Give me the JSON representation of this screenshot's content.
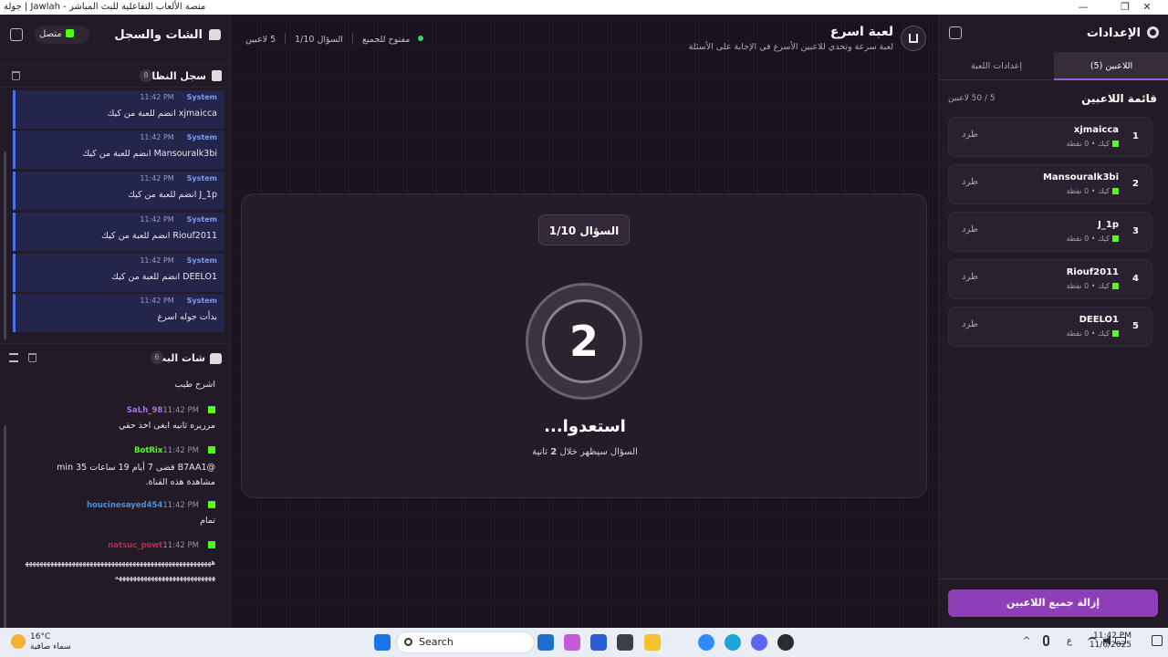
{
  "window": {
    "title": "منصة الألعاب التفاعلية للبث المباشر - Jawlah | جولة",
    "controls": [
      "—",
      "❐",
      "✕"
    ]
  },
  "left_panel": {
    "title": "الشات والسجل",
    "status": "متصل",
    "system_log": {
      "title": "سجل النظام",
      "count": "8",
      "items": [
        {
          "sender": "System",
          "time": "11:42 PM",
          "message": "xjmaicca انضم للعبة من كيك"
        },
        {
          "sender": "System",
          "time": "11:42 PM",
          "message": "Mansouralk3bi انضم للعبة من كيك"
        },
        {
          "sender": "System",
          "time": "11:42 PM",
          "message": "J_1p انضم للعبة من كيك"
        },
        {
          "sender": "System",
          "time": "11:42 PM",
          "message": "Riouf2011 انضم للعبة من كيك"
        },
        {
          "sender": "System",
          "time": "11:42 PM",
          "message": "DEELO1 انضم للعبة من كيك"
        },
        {
          "sender": "System",
          "time": "11:42 PM",
          "message": "بدأت جوله اسرع"
        }
      ]
    },
    "stream_chat": {
      "title": "شات البث",
      "count": "6",
      "messages": [
        {
          "user": "",
          "time": "",
          "text": "اشرح طيب",
          "color": "#ffffff"
        },
        {
          "user": "SaLh_98",
          "time": "11:42 PM",
          "text": "مرريره ثانيه ابغى اخذ حقي",
          "color": "#b06cf0"
        },
        {
          "user": "BotRix",
          "time": "11:42 PM",
          "text": "@B7AA1 قضى 7 أيام 19 ساعات 35 min مشاهدة هذه القناة.",
          "color": "#53fc18"
        },
        {
          "user": "houcinesayed454",
          "time": "11:42 PM",
          "text": "تمام",
          "color": "#4a90e2"
        },
        {
          "user": "natsuc_powt",
          "time": "11:42 PM",
          "text": "ههههههههههههههههههههههههههههههههههههههههههههههههههههههههههههههههههههههههههههههههه",
          "color": "#c0284d"
        }
      ]
    }
  },
  "center": {
    "title": "لعبة اسرع",
    "subtitle": "لعبة سرعة وتحدي للاعبين الأسرع في الإجابة على الأسئلة",
    "players_stat": "5 لاعبين",
    "question_stat": "السؤال 1/10",
    "access_stat": "مفتوح للجميع",
    "question_badge": "السؤال 1/10",
    "countdown": "2",
    "ready_text": "استعدوا...",
    "ready_sub_prefix": "السؤال سيظهر خلال",
    "ready_sub_num": "2",
    "ready_sub_suffix": "ثانية"
  },
  "right_panel": {
    "title": "الإعدادات",
    "tabs": [
      "اللاعبين (5)",
      "إعدادات اللعبة"
    ],
    "players_title": "قائمة اللاعبين",
    "players_count": "5 / 50 لاعبين",
    "players": [
      {
        "num": "1",
        "name": "xjmaicca",
        "info": "كيك • 0 نقطة",
        "kick": "طرد"
      },
      {
        "num": "2",
        "name": "Mansouralk3bi",
        "info": "كيك • 0 نقطة",
        "kick": "طرد"
      },
      {
        "num": "3",
        "name": "J_1p",
        "info": "كيك • 0 نقطة",
        "kick": "طرد"
      },
      {
        "num": "4",
        "name": "Riouf2011",
        "info": "كيك • 0 نقطة",
        "kick": "طرد"
      },
      {
        "num": "5",
        "name": "DEELO1",
        "info": "كيك • 0 نقطة",
        "kick": "طرد"
      }
    ],
    "remove_all": "إزالة جميع اللاعبين"
  },
  "taskbar": {
    "temp": "16°C",
    "weather": "سماء صافية",
    "search": "Search",
    "lang": "ع",
    "time": "11:42 PM",
    "date": "11/6/2025"
  },
  "colors": {
    "accent": "#8e3fb8",
    "kick_green": "#53fc18",
    "system_blue": "#4a73e8"
  }
}
